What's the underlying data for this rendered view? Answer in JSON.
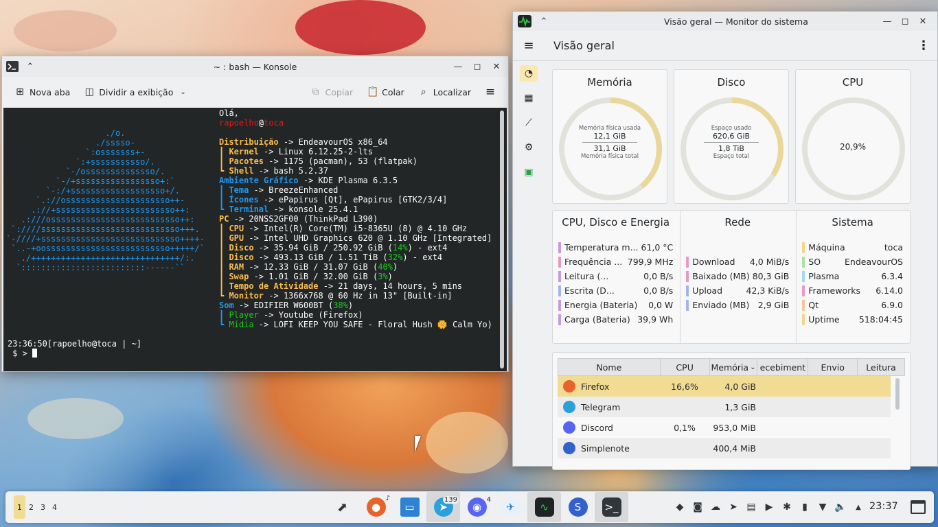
{
  "konsole": {
    "title": "~ : bash — Konsole",
    "toolbar": {
      "new_tab": "Nova aba",
      "split_view": "Dividir a exibição",
      "copy": "Copiar",
      "paste": "Colar",
      "find": "Localizar"
    },
    "logo": "                    ./o.\n                  ./sssso-\n                `:osssssss+-\n              `:+sssssssssso/.\n            `-/ossssssssssssso/.\n          `-/+sssssssssssssssso+:`\n        `-:/+sssssssssssssssssso+/.\n      `.://osssssssssssssssssssso++-\n     .://+ssssssssssssssssssssssso++:\n   .:///ossssssssssssssssssssssssso++:\n `:////ssssssssssssssssssssssssssso+++.\n`-////+ssssssssssssssssssssssssssso++++-\n `..-+oosssssssssssssssssssssssso+++++/`\n   ./++++++++++++++++++++++++++++++/:.\n  `:::::::::::::::::::::::::------``",
    "greeting": "Olá,",
    "user": "rapoelho",
    "host": "toca",
    "info": {
      "distro_label": "Distribuição",
      "distro": "EndeavourOS x86_64",
      "kernel_label": "Kernel",
      "kernel": "Linux 6.12.25-2-lts",
      "packages_label": "Pacotes",
      "packages": "1175 (pacman), 53 (flatpak)",
      "shell_label": "Shell",
      "shell": "bash 5.2.37",
      "de_label": "Ambiente Gráfico",
      "de": "KDE Plasma 6.3.5",
      "theme_label": "Tema",
      "theme": "BreezeEnhanced",
      "icons_label": "Ícones",
      "icons": "ePapirus [Qt], ePapirus [GTK2/3/4]",
      "terminal_label": "Terminal",
      "terminal": "konsole 25.4.1",
      "pc_label": "PC",
      "pc": "20NSS2GF00 (ThinkPad L390)",
      "cpu_label": "CPU",
      "cpu": "Intel(R) Core(TM) i5-8365U (8) @ 4.10 GHz",
      "gpu_label": "GPU",
      "gpu": "Intel UHD Graphics 620 @ 1.10 GHz [Integrated]",
      "disk1_label": "Disco",
      "disk1_a": "35.94 GiB / 250.92 GiB (",
      "disk1_pct": "14%",
      "disk1_b": ") - ext4",
      "disk2_label": "Disco",
      "disk2_a": "493.13 GiB / 1.51 TiB (",
      "disk2_pct": "32%",
      "disk2_b": ") - ext4",
      "ram_label": "RAM",
      "ram_a": "12.33 GiB / 31.07 GiB (",
      "ram_pct": "40%",
      "ram_b": ")",
      "swap_label": "Swap",
      "swap_a": "1.01 GiB / 32.00 GiB (",
      "swap_pct": "3%",
      "swap_b": ")",
      "uptime_label": "Tempo de Atividade",
      "uptime": "21 days, 14 hours, 5 mins",
      "monitor_label": "Monitor",
      "monitor": "1366x768 @ 60 Hz in 13\" [Built-in]",
      "sound_label": "Som",
      "sound_a": "EDIFIER W600BT (",
      "sound_pct": "38%",
      "sound_b": ")",
      "player_label": "Player",
      "player": "Youtube (Firefox)",
      "media_label": "Mídia",
      "media": "LOFI KEEP YOU SAFE - Floral Hush 🌼 Calm Yo)"
    },
    "prompt_line": "23:36:50[rapoelho@toca | ~]",
    "prompt": " $ > "
  },
  "sysmon": {
    "title": "Visão geral — Monitor do sistema",
    "page_title": "Visão geral",
    "cards": {
      "memory": {
        "title": "Memória",
        "top_label": "Memória física usada",
        "used": "12,1 GiB",
        "total": "31,1 GiB",
        "bottom_label": "Memória física total",
        "fraction": 0.39
      },
      "disk": {
        "title": "Disco",
        "top_label": "Espaço usado",
        "used": "620,6 GiB",
        "total": "1,8 TiB",
        "bottom_label": "Espaço total",
        "fraction": 0.34
      },
      "cpu": {
        "title": "CPU",
        "value": "20,9%",
        "fraction": 0.0
      }
    },
    "cpu_disk_energy": {
      "title": "CPU, Disco e Energia",
      "rows": [
        {
          "label": "Temperatura m...",
          "value": "61,0 °C",
          "color": "#c79be0"
        },
        {
          "label": "Frequência ...",
          "value": "799,9 MHz",
          "color": "#e59bc2"
        },
        {
          "label": "Leitura (...",
          "value": "0,0 B/s",
          "color": "#c79be0"
        },
        {
          "label": "Escrita (D...",
          "value": "0,0 B/s",
          "color": "#a3b6ec"
        },
        {
          "label": "Energia (Bateria)",
          "value": "0,0 W",
          "color": "#c79be0"
        },
        {
          "label": "Carga (Bateria)",
          "value": "39,9 Wh",
          "color": "#c79be0"
        }
      ]
    },
    "network": {
      "title": "Rede",
      "rows": [
        {
          "label": "Download",
          "value": "4,0 MiB/s",
          "color": "#e59bc2"
        },
        {
          "label": "Baixado (MB)",
          "value": "80,3 GiB",
          "color": "#e59bc2"
        },
        {
          "label": "Upload",
          "value": "42,3 KiB/s",
          "color": "#a3b6ec"
        },
        {
          "label": "Enviado (MB)",
          "value": "2,9 GiB",
          "color": "#a3b6ec"
        }
      ]
    },
    "system": {
      "title": "Sistema",
      "rows": [
        {
          "label": "Máquina",
          "value": "toca",
          "color": "#f0d68a"
        },
        {
          "label": "SO",
          "value": "EndeavourOS",
          "color": "#a9e3a2"
        },
        {
          "label": "Plasma",
          "value": "6.3.4",
          "color": "#a3d8ec"
        },
        {
          "label": "Frameworks",
          "value": "6.14.0",
          "color": "#e59bc2"
        },
        {
          "label": "Qt",
          "value": "6.9.0",
          "color": "#f0c89a"
        },
        {
          "label": "Uptime",
          "value": "518:04:45",
          "color": "#f0d68a"
        }
      ]
    },
    "table": {
      "headers": [
        "Nome",
        "CPU",
        "Memória",
        "ecebiment",
        "Envio",
        "Leitura"
      ],
      "rows": [
        {
          "name": "Firefox",
          "cpu": "16,6%",
          "mem": "4,0 GiB",
          "icon": "firefox-icon",
          "color": "#e8632b"
        },
        {
          "name": "Telegram",
          "cpu": "",
          "mem": "1,3 GiB",
          "icon": "telegram-icon",
          "color": "#2aa1da"
        },
        {
          "name": "Discord",
          "cpu": "0,1%",
          "mem": "953,0 MiB",
          "icon": "discord-icon",
          "color": "#5865f2"
        },
        {
          "name": "Simplenote",
          "cpu": "",
          "mem": "400,4 MiB",
          "icon": "simplenote-icon",
          "color": "#3361cc"
        }
      ]
    }
  },
  "taskbar": {
    "desktops": [
      "1",
      "2",
      "3",
      "4"
    ],
    "telegram_badge": "139",
    "discord_badge": "4",
    "clock": "23:37"
  }
}
